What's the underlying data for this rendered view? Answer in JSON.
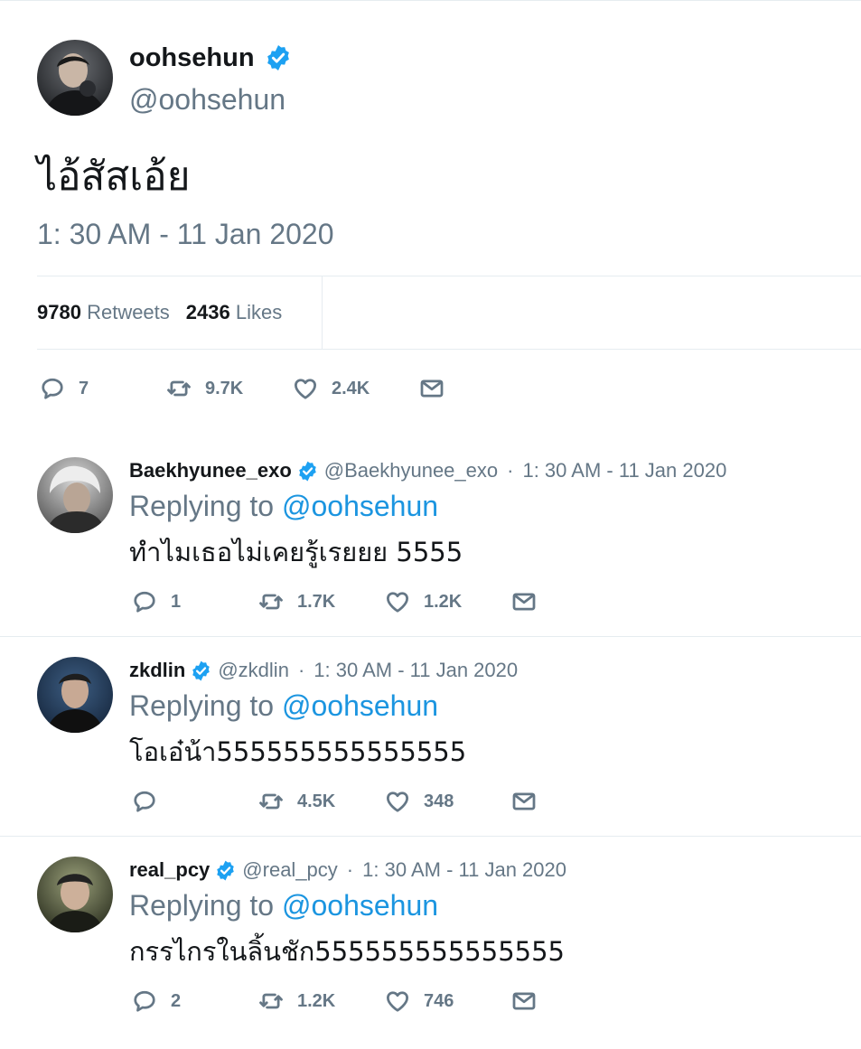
{
  "colors": {
    "accent": "#1b95e0",
    "verified": "#1da1f2",
    "muted": "#657786",
    "text": "#14171a",
    "divider": "#e6ecf0"
  },
  "icons": {
    "verified": "verified-badge-icon",
    "reply": "speech-bubble-icon",
    "retweet": "retweet-arrows-icon",
    "like": "heart-outline-icon",
    "dm": "envelope-icon"
  },
  "tweet": {
    "name": "oohsehun",
    "handle": "@oohsehun",
    "text": "ไอ้สัสเอ้ย",
    "time": "1: 30 AM - 11 Jan 2020",
    "stats": {
      "retweets": "9780",
      "retweets_label": "Retweets",
      "likes": "2436",
      "likes_label": "Likes"
    },
    "actions": {
      "replies": "7",
      "retweets": "9.7K",
      "likes": "2.4K"
    }
  },
  "replies": [
    {
      "name": "Baekhyunee_exo",
      "handle": "@Baekhyunee_exo",
      "dot": "·",
      "time": "1: 30 AM - 11 Jan 2020",
      "replying_label": "Replying to",
      "replying_to": "@oohsehun",
      "text": "ทำไมเธอไม่เคยรู้เรยยย 5555",
      "actions": {
        "replies": "1",
        "retweets": "1.7K",
        "likes": "1.2K"
      }
    },
    {
      "name": "zkdlin",
      "handle": "@zkdlin",
      "dot": "·",
      "time": "1: 30 AM - 11 Jan 2020",
      "replying_label": "Replying to",
      "replying_to": "@oohsehun",
      "text": "โอเอ๋น้า555555555555555",
      "actions": {
        "replies": "",
        "retweets": "4.5K",
        "likes": "348"
      }
    },
    {
      "name": "real_pcy",
      "handle": "@real_pcy",
      "dot": "·",
      "time": "1: 30 AM - 11 Jan 2020",
      "replying_label": "Replying to",
      "replying_to": "@oohsehun",
      "text": "กรรไกรในลิ้นชัก555555555555555",
      "actions": {
        "replies": "2",
        "retweets": "1.2K",
        "likes": "746"
      }
    }
  ]
}
